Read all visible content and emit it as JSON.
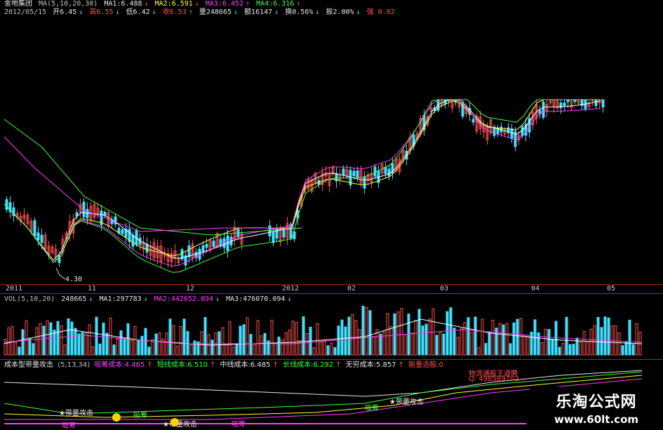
{
  "main": {
    "stock_name": "金地集团",
    "ma_params": "MA(5,10,20,30)",
    "ma1": "MA1:6.488",
    "ma2": "MA2:6.591",
    "ma3": "MA3:6.452",
    "ma4": "MA4:6.316",
    "date": "2012/05/15",
    "open": "开6.45",
    "high": "高6.55",
    "low": "低6.42",
    "close": "收6.53",
    "volume": "量248665",
    "amount": "额16147",
    "turnover": "换0.56%",
    "amplitude": "振2.00%",
    "strength": "强 0.02",
    "low_marker": "4.30"
  },
  "x_axis": [
    "2011",
    "11",
    "12",
    "2012",
    "02",
    "03",
    "04",
    "05"
  ],
  "vol": {
    "params": "VOL(5,10,20)",
    "value": "248665",
    "ma1": "MA1:297783",
    "ma2": "MA2:442652.094",
    "ma3": "MA3:476070.094"
  },
  "indicator": {
    "name": "成本型带量攻击",
    "params": "(5,13,34)",
    "chip_cost": "吸筹成本:4.465",
    "short_cost": "短线成本:6.510",
    "mid_cost": "中线成本:6.485",
    "long_cost": "长线成本:6.292",
    "inf_cost": "无穷成本:5.857",
    "energy": "能量选股:0",
    "sig_attack1": "★带量攻击",
    "sig_attack2": "★带量攻击",
    "sig_attack3": "★带量攻击",
    "sig_chip1": "吸筹",
    "sig_chip2": "吸筹",
    "sig_chip3": "吸筹",
    "sig_chip4": "吸筹",
    "overlay1": "物流通股王道聘",
    "overlay2": "Q: 498589702"
  },
  "watermark": {
    "line1": "乐淘公式网",
    "line2": "www.60lt.com"
  },
  "colors": {
    "up": "#ff5050",
    "down": "#40e0ff",
    "ma1": "#ffffff",
    "ma2": "#ffff40",
    "ma3": "#ff40ff",
    "ma4": "#40ff40",
    "divider": "#b02020"
  }
}
